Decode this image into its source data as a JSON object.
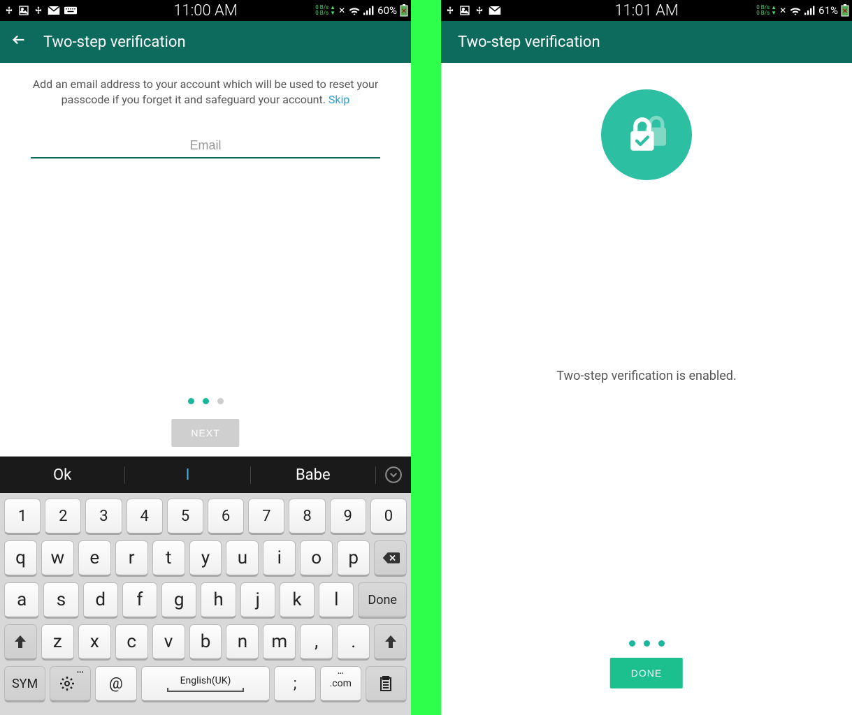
{
  "left": {
    "status": {
      "time": "11:00 AM",
      "data": "0 B/s ▲\n0 B/s ▼",
      "battery": "60%"
    },
    "appbar": {
      "title": "Two-step verification"
    },
    "instruction": "Add an email address to your account which will be used to reset your passcode if you forget it and safeguard your account.",
    "skip": "Skip",
    "email_placeholder": "Email",
    "next": "NEXT",
    "keyboard": {
      "suggestions": [
        "Ok",
        "I",
        "Babe"
      ],
      "row_num": [
        "1",
        "2",
        "3",
        "4",
        "5",
        "6",
        "7",
        "8",
        "9",
        "0"
      ],
      "row1": [
        "q",
        "w",
        "e",
        "r",
        "t",
        "y",
        "u",
        "i",
        "o",
        "p"
      ],
      "row2": [
        "a",
        "s",
        "d",
        "f",
        "g",
        "h",
        "j",
        "k",
        "l"
      ],
      "row3": [
        "z",
        "x",
        "c",
        "v",
        "b",
        "n",
        "m",
        ",",
        "."
      ],
      "sym": "SYM",
      "at": "@",
      "lang": "English(UK)",
      "semi": ";",
      "com": ".com",
      "done": "Done",
      "backspace": "⌫",
      "shift": "⬆"
    }
  },
  "right": {
    "status": {
      "time": "11:01 AM",
      "data": "0 B/s ▲\n0 B/s ▼",
      "battery": "61%"
    },
    "appbar": {
      "title": "Two-step verification"
    },
    "enabled": "Two-step verification is enabled.",
    "done": "DONE"
  }
}
